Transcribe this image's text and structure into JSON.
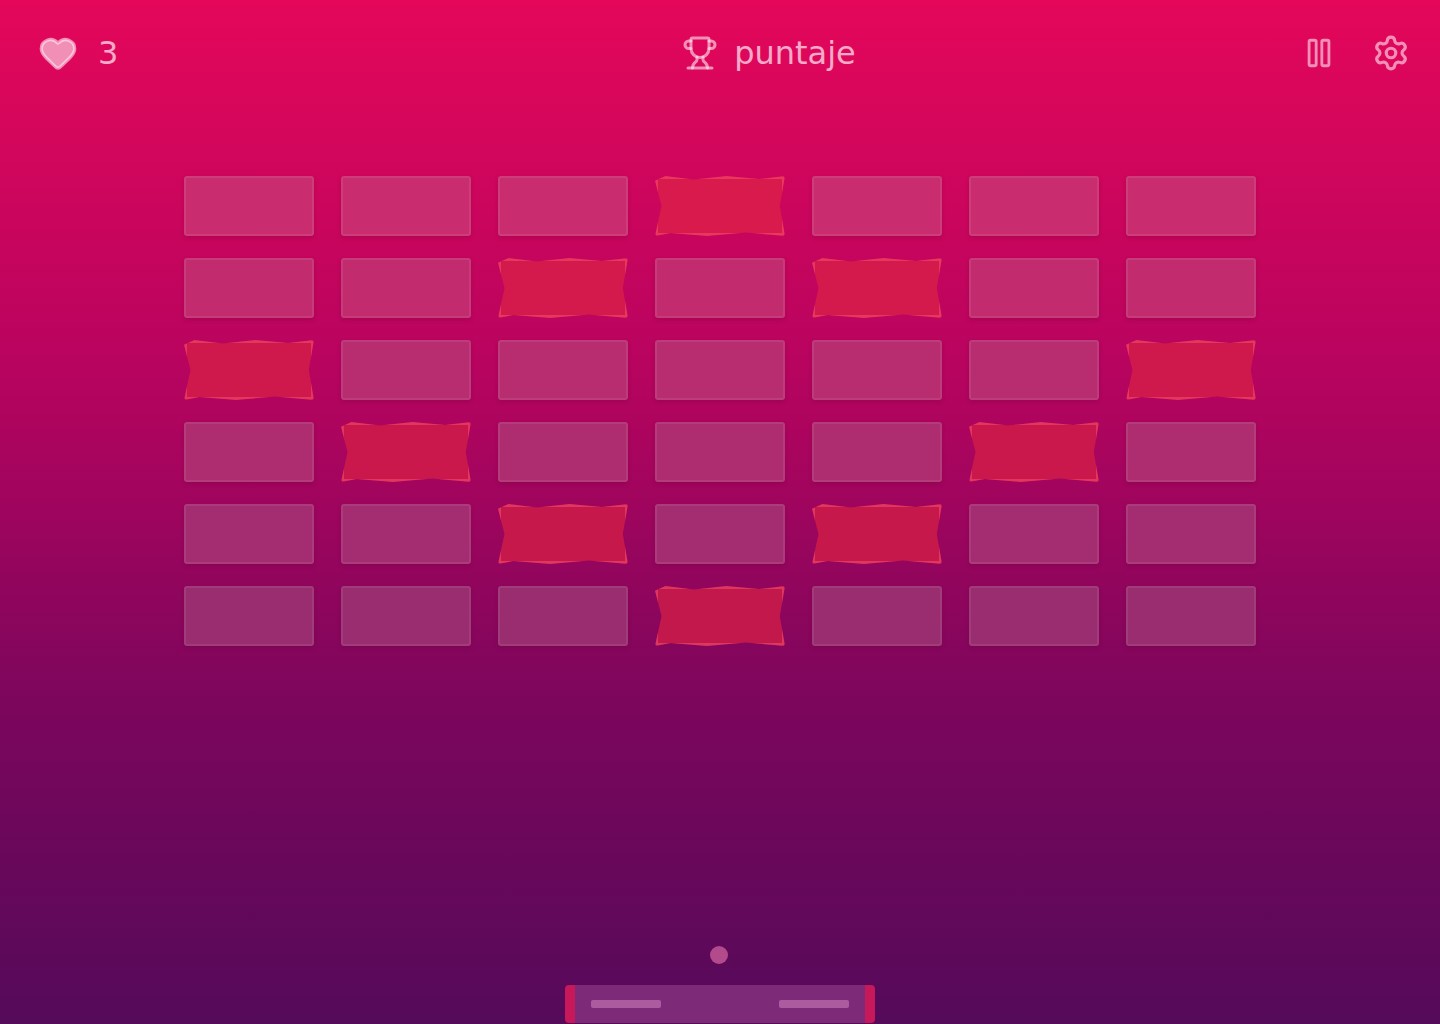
{
  "hud": {
    "lives": "3",
    "score_label": "puntaje"
  },
  "bricks": [
    [
      {
        "kind": "normal",
        "color": "#c92d6f"
      },
      {
        "kind": "normal",
        "color": "#c92d6f"
      },
      {
        "kind": "normal",
        "color": "#c92d6f"
      },
      {
        "kind": "strong",
        "color": "#d81a4c"
      },
      {
        "kind": "normal",
        "color": "#c92d6f"
      },
      {
        "kind": "normal",
        "color": "#c92d6f"
      },
      {
        "kind": "normal",
        "color": "#c92d6f"
      }
    ],
    [
      {
        "kind": "normal",
        "color": "#c22c6f"
      },
      {
        "kind": "normal",
        "color": "#c22c6f"
      },
      {
        "kind": "strong",
        "color": "#d41a4c"
      },
      {
        "kind": "normal",
        "color": "#c22c6f"
      },
      {
        "kind": "strong",
        "color": "#d41a4c"
      },
      {
        "kind": "normal",
        "color": "#c22c6f"
      },
      {
        "kind": "normal",
        "color": "#c22c6f"
      }
    ],
    [
      {
        "kind": "strong",
        "color": "#cf194c"
      },
      {
        "kind": "normal",
        "color": "#b82c70"
      },
      {
        "kind": "normal",
        "color": "#b82c70"
      },
      {
        "kind": "normal",
        "color": "#b82c70"
      },
      {
        "kind": "normal",
        "color": "#b82c70"
      },
      {
        "kind": "normal",
        "color": "#b82c70"
      },
      {
        "kind": "strong",
        "color": "#cf194c"
      }
    ],
    [
      {
        "kind": "normal",
        "color": "#ae2c70"
      },
      {
        "kind": "strong",
        "color": "#ca184c"
      },
      {
        "kind": "normal",
        "color": "#ae2c70"
      },
      {
        "kind": "normal",
        "color": "#ae2c70"
      },
      {
        "kind": "normal",
        "color": "#ae2c70"
      },
      {
        "kind": "strong",
        "color": "#ca184c"
      },
      {
        "kind": "normal",
        "color": "#ae2c70"
      }
    ],
    [
      {
        "kind": "normal",
        "color": "#a42c70"
      },
      {
        "kind": "normal",
        "color": "#a42c70"
      },
      {
        "kind": "strong",
        "color": "#c7184c"
      },
      {
        "kind": "normal",
        "color": "#a42c70"
      },
      {
        "kind": "strong",
        "color": "#c7184c"
      },
      {
        "kind": "normal",
        "color": "#a42c70"
      },
      {
        "kind": "normal",
        "color": "#a42c70"
      }
    ],
    [
      {
        "kind": "normal",
        "color": "#9a2c70"
      },
      {
        "kind": "normal",
        "color": "#9a2c70"
      },
      {
        "kind": "normal",
        "color": "#9a2c70"
      },
      {
        "kind": "strong",
        "color": "#c2184c"
      },
      {
        "kind": "normal",
        "color": "#9a2c70"
      },
      {
        "kind": "normal",
        "color": "#9a2c70"
      },
      {
        "kind": "normal",
        "color": "#9a2c70"
      }
    ]
  ]
}
